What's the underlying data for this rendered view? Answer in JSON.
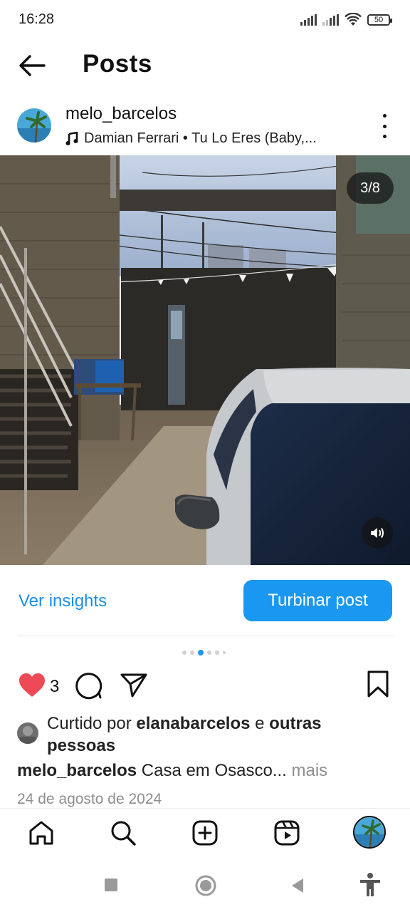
{
  "status_bar": {
    "time": "16:28",
    "battery": "50",
    "icons": [
      "signal-icon",
      "signal-icon",
      "wifi-icon",
      "battery-icon"
    ]
  },
  "header": {
    "title": "Posts",
    "back_icon": "back-arrow-icon"
  },
  "post": {
    "username": "melo_barcelos",
    "music": "Damian Ferrari • Tu Lo Eres (Baby,...",
    "slide_counter": "3/8",
    "insights_label": "Ver insights",
    "boost_label": "Turbinar post",
    "like_count": "3",
    "liked_by_prefix": "Curtido por ",
    "liked_by_user": "elanabarcelos",
    "liked_by_mid": " e ",
    "liked_by_others": "outras pessoas",
    "caption_user": "melo_barcelos",
    "caption_text": " Casa em Osasco... ",
    "caption_more": "mais",
    "date": "24 de agosto de 2024",
    "carousel": {
      "total": 8,
      "active_index": 2
    }
  },
  "colors": {
    "accent": "#1a97f0",
    "link": "#1c8ee4",
    "like": "#ed4956",
    "muted": "#8e8e8e"
  },
  "bottom_nav": [
    "home-icon",
    "search-icon",
    "create-icon",
    "reels-icon",
    "profile-avatar"
  ],
  "system_nav": [
    "recents-icon",
    "home-circle-icon",
    "back-triangle-icon",
    "accessibility-icon"
  ]
}
